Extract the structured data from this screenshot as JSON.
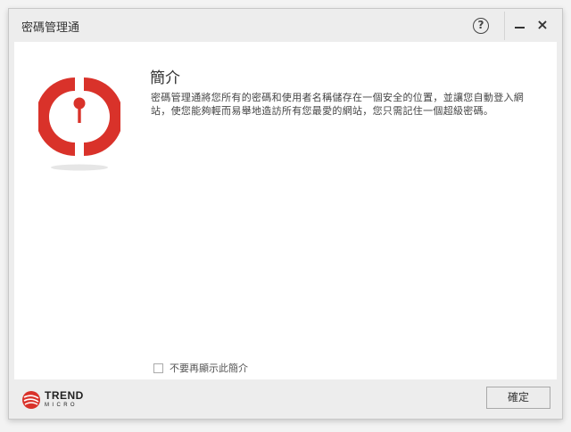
{
  "window": {
    "title": "密碼管理通"
  },
  "titlebar": {
    "help_label": "?",
    "close_label": "×"
  },
  "intro": {
    "heading": "簡介",
    "description": "密碼管理通將您所有的密碼和使用者名稱儲存在一個安全的位置，並讓您自動登入網站，使您能夠輕而易舉地造訪所有您最愛的網站，您只需記住一個超級密碼。"
  },
  "options": {
    "dont_show_label": "不要再顯示此簡介",
    "dont_show_checked": false
  },
  "footer": {
    "brand_trend": "TREND",
    "brand_micro": "MICRO",
    "ok_label": "確定"
  },
  "colors": {
    "brand_red": "#d9322a",
    "window_bg": "#ededed",
    "content_bg": "#ffffff"
  },
  "icons": {
    "app_logo": "password-manager-keyhole-icon",
    "help": "question-circle-icon",
    "minimize": "minimize-icon",
    "close": "close-icon",
    "brand": "trend-micro-logo-icon"
  }
}
